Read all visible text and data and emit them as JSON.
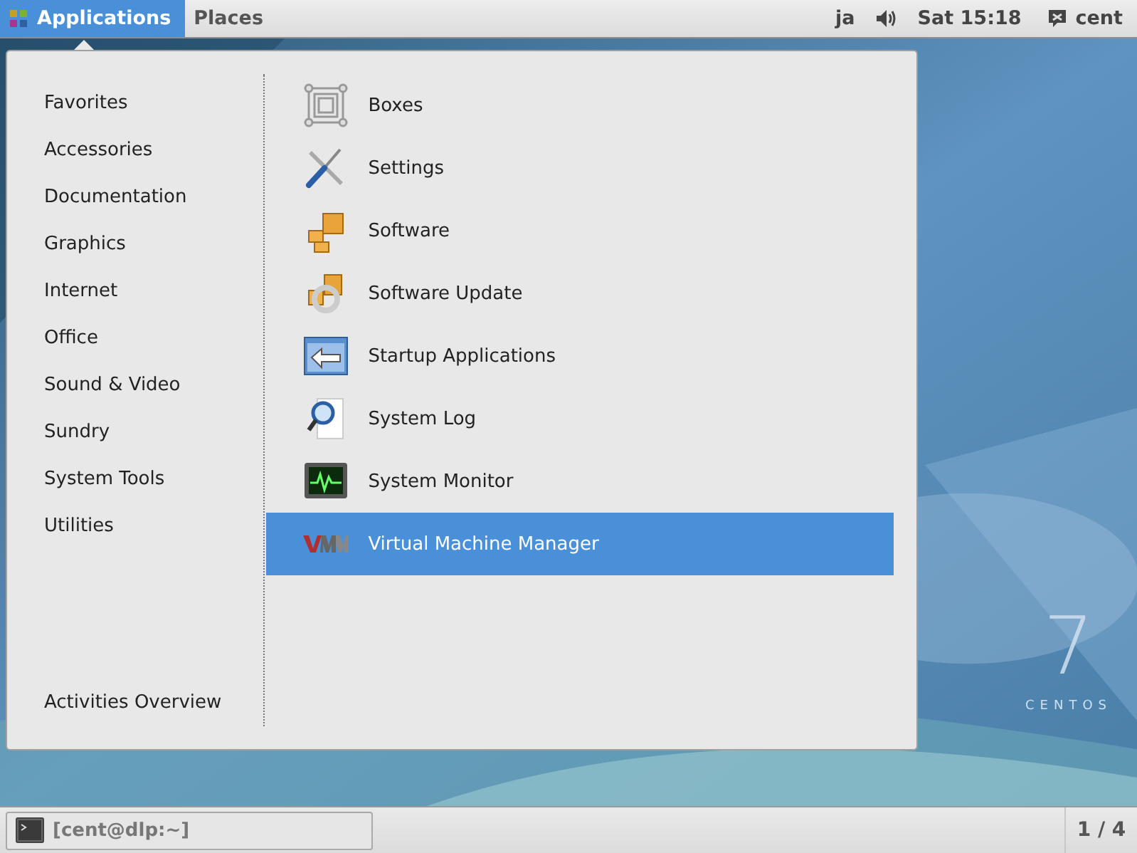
{
  "top_bar": {
    "menus": [
      {
        "label": "Applications",
        "selected": true
      },
      {
        "label": "Places",
        "selected": false
      }
    ],
    "input_method": "ja",
    "clock": "Sat 15:18",
    "user": "cent"
  },
  "menu": {
    "categories": [
      "Favorites",
      "Accessories",
      "Documentation",
      "Graphics",
      "Internet",
      "Office",
      "Sound & Video",
      "Sundry",
      "System Tools",
      "Utilities"
    ],
    "footer": "Activities Overview",
    "apps": [
      {
        "label": "Boxes",
        "selected": false
      },
      {
        "label": "Settings",
        "selected": false
      },
      {
        "label": "Software",
        "selected": false
      },
      {
        "label": "Software Update",
        "selected": false
      },
      {
        "label": "Startup Applications",
        "selected": false
      },
      {
        "label": "System Log",
        "selected": false
      },
      {
        "label": "System Monitor",
        "selected": false
      },
      {
        "label": "Virtual Machine Manager",
        "selected": true
      }
    ]
  },
  "wallpaper": {
    "kind": "picture",
    "logo_number": "7",
    "logo_text": "CENTOS"
  },
  "bottom_bar": {
    "windows": [
      {
        "label": "[cent@dlp:~]"
      }
    ],
    "workspace": "1 / 4"
  }
}
